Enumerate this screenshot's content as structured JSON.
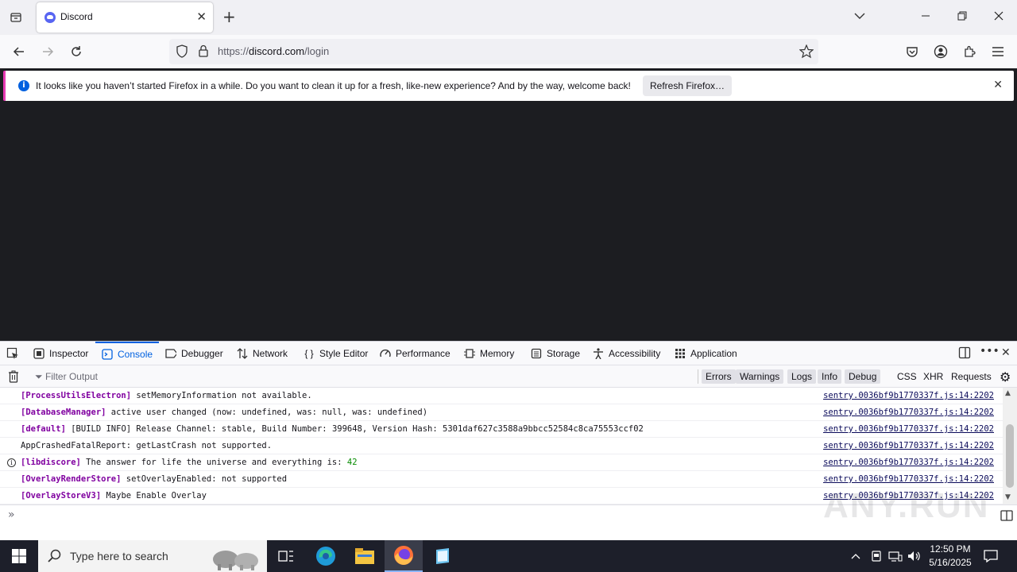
{
  "browser": {
    "tab_title": "Discord",
    "url_domain": "discord.com",
    "url_prefix": "https://",
    "url_path": "/login"
  },
  "notification": {
    "message": "It looks like you haven’t started Firefox in a while. Do you want to clean it up for a fresh, like-new experience? And by the way, welcome back!",
    "button": "Refresh Firefox…"
  },
  "devtools": {
    "tabs": [
      "Inspector",
      "Console",
      "Debugger",
      "Network",
      "Style Editor",
      "Performance",
      "Memory",
      "Storage",
      "Accessibility",
      "Application"
    ],
    "active_tab": "Console",
    "filter_placeholder": "Filter Output",
    "filters": [
      "Errors",
      "Warnings",
      "Logs",
      "Info",
      "Debug"
    ],
    "extra_filters": [
      "CSS",
      "XHR",
      "Requests"
    ],
    "log_rows": [
      {
        "tag": "[ProcessUtilsElectron]",
        "text": " setMemoryInformation not available.",
        "source": "sentry.0036bf9b1770337f.js:14:2202"
      },
      {
        "tag": "[DatabaseManager]",
        "text": " active user changed (now: undefined, was: null, was: undefined)",
        "source": "sentry.0036bf9b1770337f.js:14:2202"
      },
      {
        "tag": "[default]",
        "text": " [BUILD INFO] Release Channel: stable, Build Number: 399648, Version Hash: 5301daf627c3588a9bbcc52584c8ca75553ccf02",
        "source": "sentry.0036bf9b1770337f.js:14:2202"
      },
      {
        "tag": "",
        "text": "AppCrashedFatalReport: getLastCrash not supported.",
        "source": "sentry.0036bf9b1770337f.js:14:2202"
      },
      {
        "tag": "[libdiscore]",
        "text": " The answer for life the universe and everything is: ",
        "num": "42",
        "source": "sentry.0036bf9b1770337f.js:14:2202",
        "info": true
      },
      {
        "tag": "[OverlayRenderStore]",
        "text": " setOverlayEnabled: not supported",
        "source": "sentry.0036bf9b1770337f.js:14:2202"
      },
      {
        "tag": "[OverlayStoreV3]",
        "text": " Maybe Enable Overlay",
        "source": "sentry.0036bf9b1770337f.js:14:2202"
      }
    ]
  },
  "taskbar": {
    "search_placeholder": "Type here to search",
    "time": "12:50 PM",
    "date": "5/16/2025"
  },
  "watermark": "ANY.RUN"
}
